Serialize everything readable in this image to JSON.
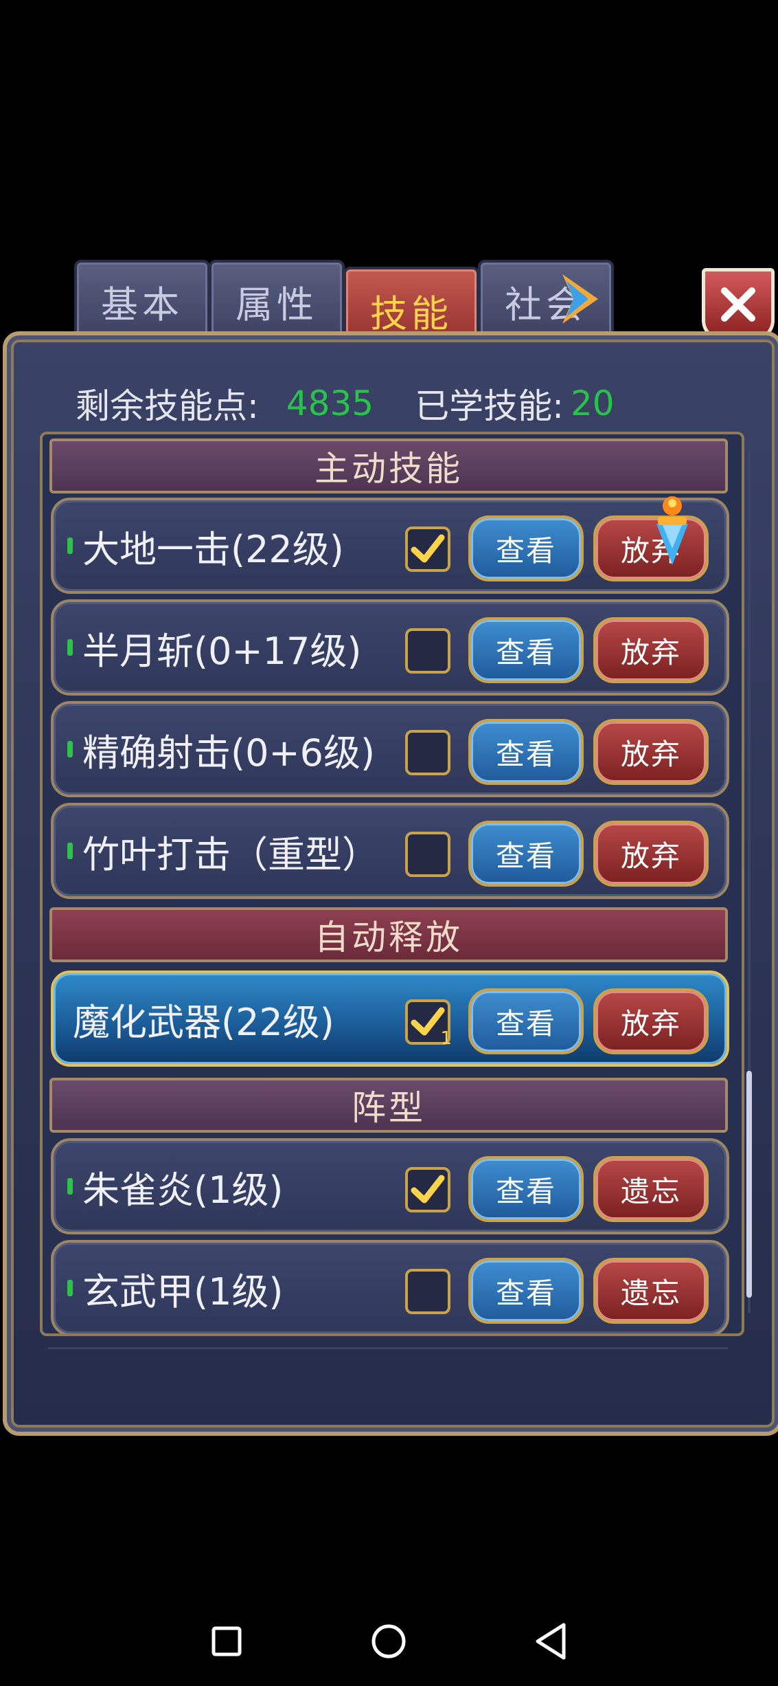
{
  "tabs": [
    {
      "label": "基本",
      "active": false
    },
    {
      "label": "属性",
      "active": false
    },
    {
      "label": "技能",
      "active": true
    },
    {
      "label": "社会",
      "active": false
    }
  ],
  "stats": {
    "remaining_label": "剩余技能点:",
    "remaining_value": "4835",
    "learned_label": "已学技能:",
    "learned_value": "20"
  },
  "sections": {
    "active": "主动技能",
    "auto": "自动释放",
    "formation": "阵型"
  },
  "skills": [
    {
      "name": "大地一击(22级)",
      "checked": true,
      "view": "查看",
      "drop": "放弃"
    },
    {
      "name": "半月斩(0+17级)",
      "checked": false,
      "view": "查看",
      "drop": "放弃"
    },
    {
      "name": "精确射击(0+6级)",
      "checked": false,
      "view": "查看",
      "drop": "放弃"
    },
    {
      "name": "竹叶打击（重型）",
      "checked": false,
      "view": "查看",
      "drop": "放弃"
    },
    {
      "name": "魔化武器(22级)",
      "checked": true,
      "count": "1",
      "view": "查看",
      "drop": "放弃"
    },
    {
      "name": "朱雀炎(1级)",
      "checked": true,
      "view": "查看",
      "drop": "遗忘"
    },
    {
      "name": "玄武甲(1级)",
      "checked": false,
      "view": "查看",
      "drop": "遗忘"
    }
  ],
  "colors": {
    "accent_green": "#29c24a",
    "active_tab": "#8e2c2c",
    "gold": "#ffd34a"
  },
  "icons": [
    "next-arrow-icon",
    "close-icon",
    "checkmark-icon",
    "gem-icon",
    "square-icon",
    "circle-icon",
    "back-triangle-icon"
  ]
}
